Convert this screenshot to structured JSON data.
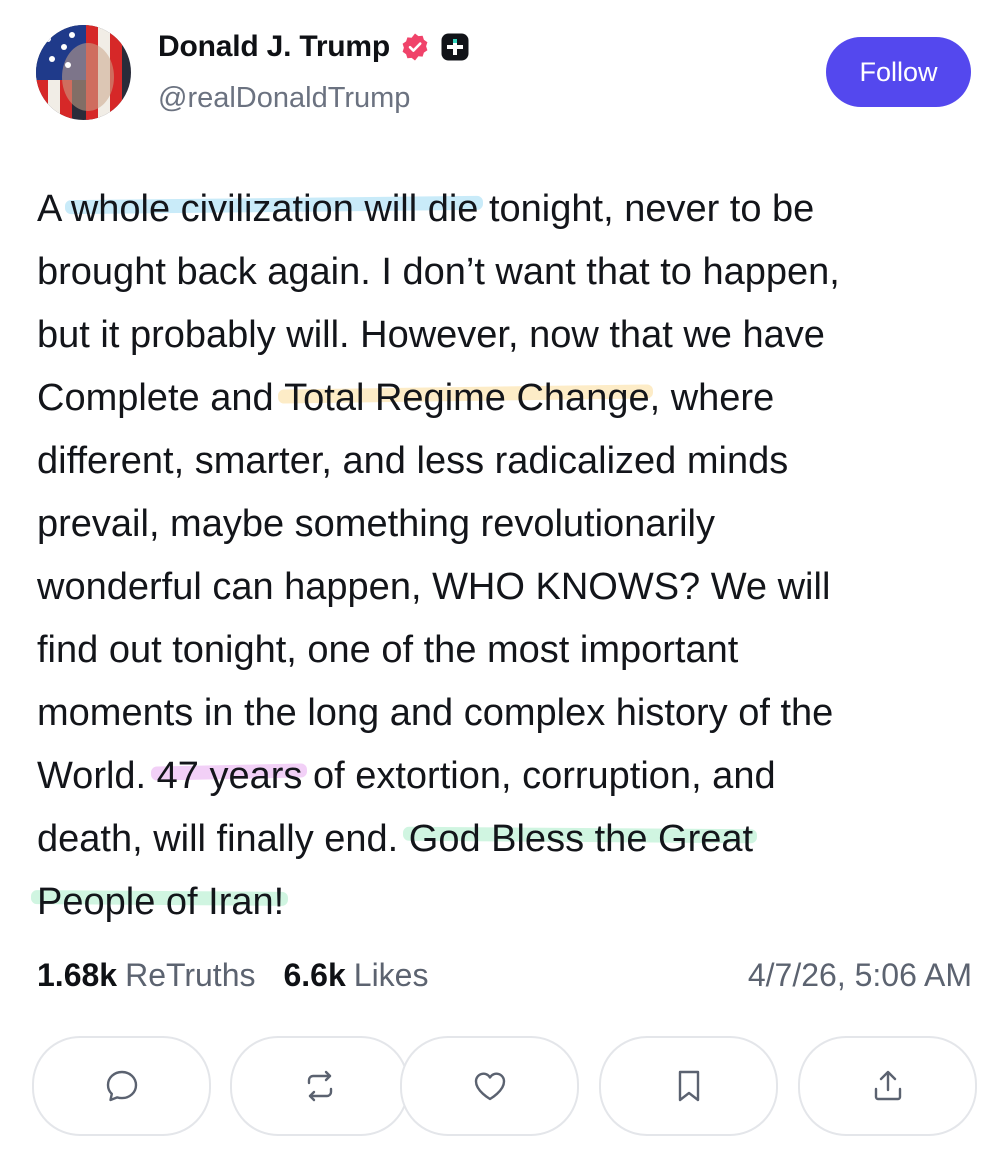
{
  "author": {
    "display_name": "Donald J. Trump",
    "handle": "@realDonaldTrump"
  },
  "follow_label": "Follow",
  "post_lines": [
    [
      {
        "t": "A "
      },
      {
        "t": "whole civilization will die",
        "hl": "blue"
      },
      {
        "t": " tonight, never to be"
      }
    ],
    [
      {
        "t": "brought back again. I don’t want that to happen,"
      }
    ],
    [
      {
        "t": "but it probably will. However, now that we have"
      }
    ],
    [
      {
        "t": "Complete and "
      },
      {
        "t": "Total Regime Change",
        "hl": "yellow"
      },
      {
        "t": ", where"
      }
    ],
    [
      {
        "t": "different, smarter, and less radicalized minds"
      }
    ],
    [
      {
        "t": "prevail, maybe something revolutionarily"
      }
    ],
    [
      {
        "t": "wonderful can happen, WHO KNOWS? We will"
      }
    ],
    [
      {
        "t": "find out tonight, one of the most important"
      }
    ],
    [
      {
        "t": "moments in the long and complex history of the"
      }
    ],
    [
      {
        "t": "World. "
      },
      {
        "t": "47 years",
        "hl": "purple"
      },
      {
        "t": " of extortion, corruption, and"
      }
    ],
    [
      {
        "t": "death, will finally end. "
      },
      {
        "t": "God Bless the Great",
        "hl": "green"
      }
    ],
    [
      {
        "t": "People of Iran!",
        "hl": "green"
      }
    ]
  ],
  "stats": {
    "retruths_count": "1.68k",
    "retruths_label": "ReTruths",
    "likes_count": "6.6k",
    "likes_label": "Likes",
    "timestamp": "4/7/26, 5:06 AM"
  },
  "actions": [
    {
      "name": "reply-button",
      "icon": "comment-icon"
    },
    {
      "name": "retruth-button",
      "icon": "repost-icon"
    },
    {
      "name": "like-button",
      "icon": "heart-icon"
    },
    {
      "name": "bookmark-button",
      "icon": "bookmark-icon"
    },
    {
      "name": "share-button",
      "icon": "share-icon"
    }
  ],
  "colors": {
    "follow_button": "#5448ee",
    "verified_badge": "#f0436a",
    "highlight_blue": "#bfe7f8",
    "highlight_yellow": "#fde9bd",
    "highlight_purple": "#f0c8f6",
    "highlight_green": "#c8f3dc"
  }
}
